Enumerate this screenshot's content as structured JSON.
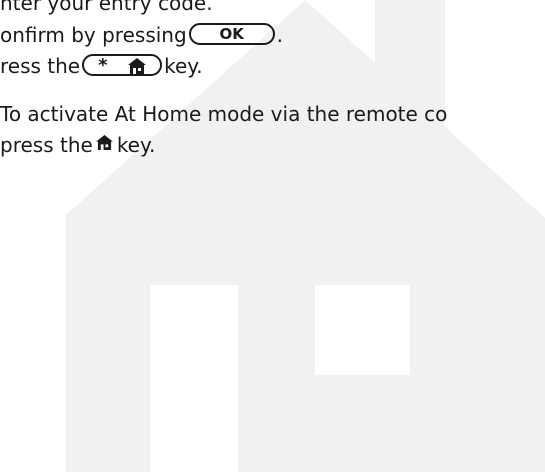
{
  "instructions": {
    "line1": "nter your entry code.",
    "line2_before": "onfirm by pressing ",
    "ok_key_label": "OK",
    "line2_after": ".",
    "line3_before": "ress the ",
    "star_key_label": "*",
    "line3_after": " key.",
    "line4": "To activate At Home mode via the remote co",
    "line5_before": "press the ",
    "line5_after": "key."
  },
  "icons": {
    "home": "home-icon",
    "watermark": "house-watermark"
  },
  "colors": {
    "text": "#1a1a1a",
    "watermark": "#f1f1f1",
    "background": "#ffffff"
  }
}
